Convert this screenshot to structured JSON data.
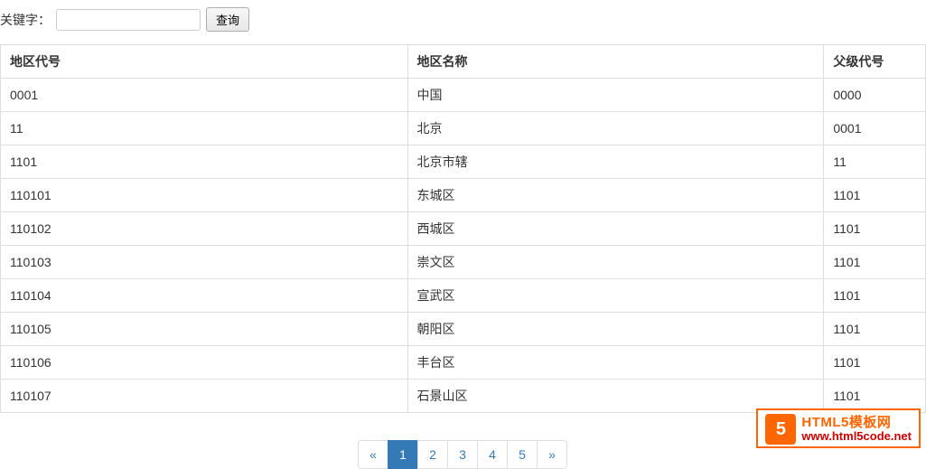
{
  "search": {
    "label": "关键字：",
    "value": "",
    "button": "查询"
  },
  "table": {
    "headers": {
      "code": "地区代号",
      "name": "地区名称",
      "parent": "父级代号"
    },
    "rows": [
      {
        "code": "0001",
        "name": "中国",
        "parent": "0000"
      },
      {
        "code": "11",
        "name": "北京",
        "parent": "0001"
      },
      {
        "code": "1101",
        "name": "北京市辖",
        "parent": "11"
      },
      {
        "code": "110101",
        "name": "东城区",
        "parent": "1101"
      },
      {
        "code": "110102",
        "name": "西城区",
        "parent": "1101"
      },
      {
        "code": "110103",
        "name": "崇文区",
        "parent": "1101"
      },
      {
        "code": "110104",
        "name": "宣武区",
        "parent": "1101"
      },
      {
        "code": "110105",
        "name": "朝阳区",
        "parent": "1101"
      },
      {
        "code": "110106",
        "name": "丰台区",
        "parent": "1101"
      },
      {
        "code": "110107",
        "name": "石景山区",
        "parent": "1101"
      }
    ]
  },
  "pagination": {
    "prev": "«",
    "next": "»",
    "pages": [
      "1",
      "2",
      "3",
      "4",
      "5"
    ],
    "active": "1"
  },
  "watermark": {
    "logo": "5",
    "title": "HTML5模板网",
    "url": "www.html5code.net"
  }
}
